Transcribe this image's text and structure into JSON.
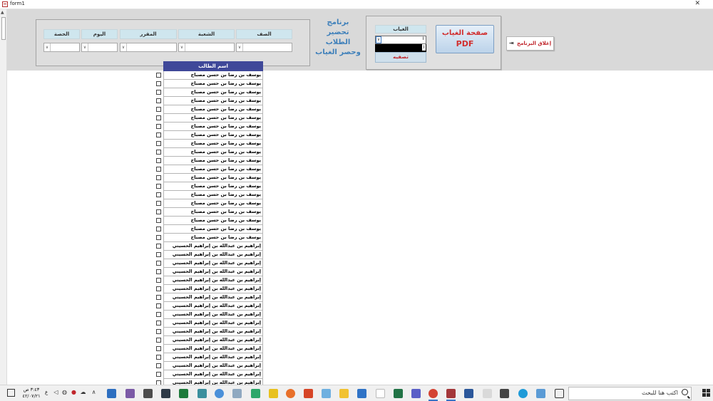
{
  "window": {
    "title": "form1",
    "close": "✕"
  },
  "filters": {
    "columns": [
      {
        "key": "class",
        "label": "الصف"
      },
      {
        "key": "section",
        "label": "الشعبة"
      },
      {
        "key": "course",
        "label": "المقرر"
      },
      {
        "key": "day",
        "label": "اليوم"
      },
      {
        "key": "period",
        "label": "الحصة"
      }
    ]
  },
  "program_title": "برنامج تحضير الطلاب وحصر الغياب",
  "absence": {
    "label": "الغياب",
    "filter_button": "تصفيه",
    "pdf_button_line1": "صفحة الغياب",
    "pdf_button_line2": "PDF"
  },
  "close_button": "إغلاق البرنامج",
  "students_list": {
    "header": "اسم الطالب",
    "rows": [
      "يوسف بن رضا بن حسن مصباح",
      "يوسف بن رضا بن حسن مصباح",
      "يوسف بن رضا بن حسن مصباح",
      "يوسف بن رضا بن حسن مصباح",
      "يوسف بن رضا بن حسن مصباح",
      "يوسف بن رضا بن حسن مصباح",
      "يوسف بن رضا بن حسن مصباح",
      "يوسف بن رضا بن حسن مصباح",
      "يوسف بن رضا بن حسن مصباح",
      "يوسف بن رضا بن حسن مصباح",
      "يوسف بن رضا بن حسن مصباح",
      "يوسف بن رضا بن حسن مصباح",
      "يوسف بن رضا بن حسن مصباح",
      "يوسف بن رضا بن حسن مصباح",
      "يوسف بن رضا بن حسن مصباح",
      "يوسف بن رضا بن حسن مصباح",
      "يوسف بن رضا بن حسن مصباح",
      "يوسف بن رضا بن حسن مصباح",
      "يوسف بن رضا بن حسن مصباح",
      "يوسف بن رضا بن حسن مصباح",
      "إبراهيم بن عبدالله بن إبراهيم الحسيني",
      "إبراهيم بن عبدالله بن إبراهيم الحسيني",
      "إبراهيم بن عبدالله بن إبراهيم الحسيني",
      "إبراهيم بن عبدالله بن إبراهيم الحسيني",
      "إبراهيم بن عبدالله بن إبراهيم الحسيني",
      "إبراهيم بن عبدالله بن إبراهيم الحسيني",
      "إبراهيم بن عبدالله بن إبراهيم الحسيني",
      "إبراهيم بن عبدالله بن إبراهيم الحسيني",
      "إبراهيم بن عبدالله بن إبراهيم الحسيني",
      "إبراهيم بن عبدالله بن إبراهيم الحسيني",
      "إبراهيم بن عبدالله بن إبراهيم الحسيني",
      "إبراهيم بن عبدالله بن إبراهيم الحسيني",
      "إبراهيم بن عبدالله بن إبراهيم الحسيني",
      "إبراهيم بن عبدالله بن إبراهيم الحسيني",
      "إبراهيم بن عبدالله بن إبراهيم الحسيني",
      "إبراهيم بن عبدالله بن إبراهيم الحسيني",
      "إبراهيم بن عبدالله بن إبراهيم الحسيني"
    ]
  },
  "taskbar": {
    "search_placeholder": "اكتب هنا للبحث",
    "time": "٣:٤٣ ص",
    "date": "٤٢/٠٧/٢١",
    "language": "ع"
  }
}
